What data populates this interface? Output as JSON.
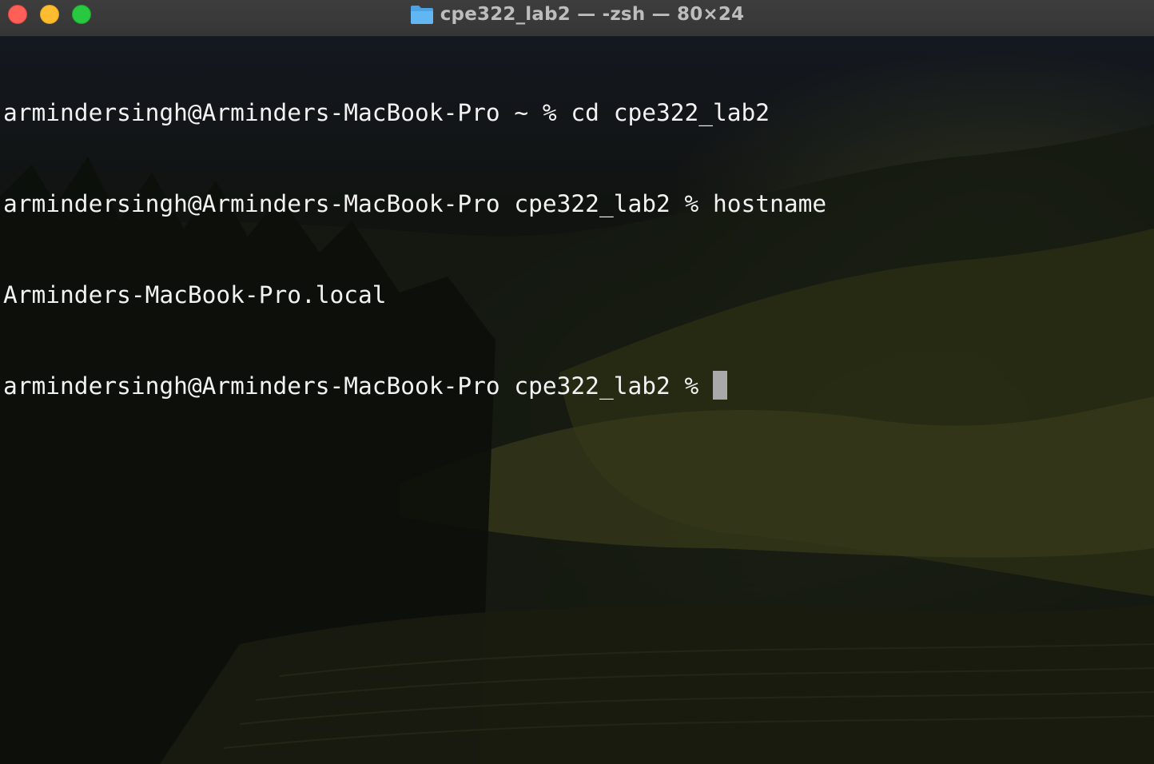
{
  "window": {
    "title": "cpe322_lab2 — -zsh — 80×24",
    "folder_icon": "folder-icon",
    "title_color": "#bdbdbd",
    "controls": {
      "close_color": "#fe5f57",
      "minimize_color": "#febc2e",
      "zoom_color": "#28c840"
    }
  },
  "terminal": {
    "text_color": "#f2f2f2",
    "lines": [
      "armindersingh@Arminders-MacBook-Pro ~ % cd cpe322_lab2",
      "armindersingh@Arminders-MacBook-Pro cpe322_lab2 % hostname",
      "Arminders-MacBook-Pro.local",
      "armindersingh@Arminders-MacBook-Pro cpe322_lab2 %"
    ]
  }
}
